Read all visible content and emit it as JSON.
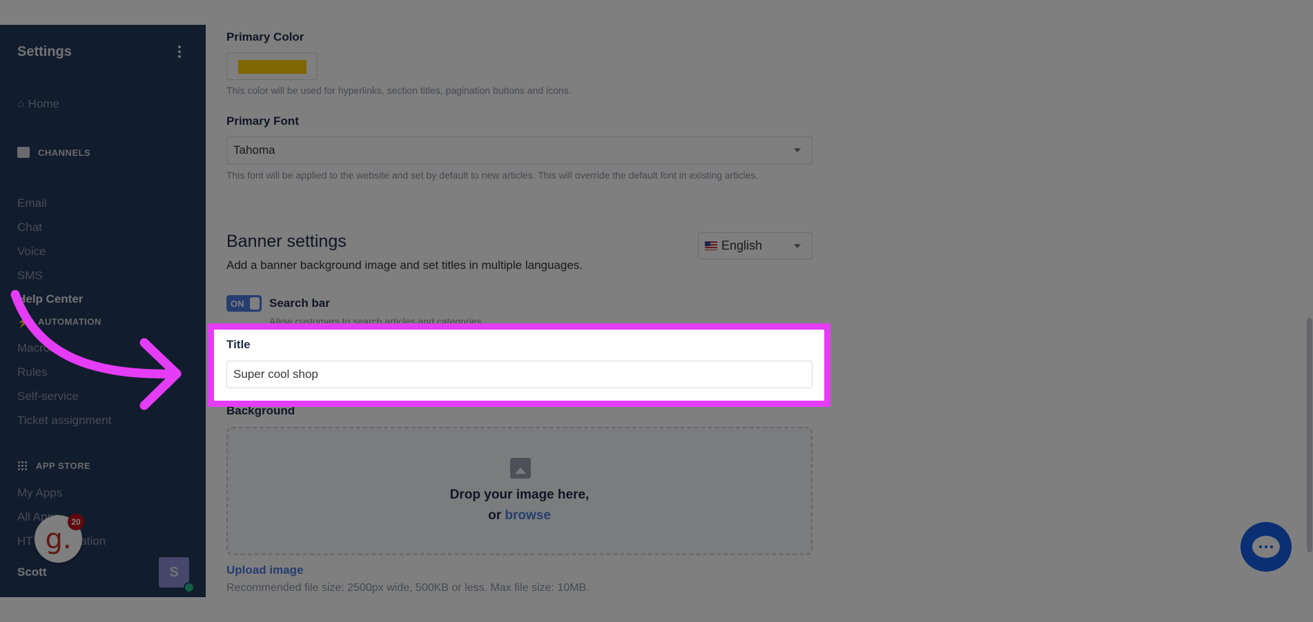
{
  "sidebar": {
    "title": "Settings",
    "home": "Home",
    "sections": [
      {
        "label": "CHANNELS",
        "icon": "chat-icon",
        "items": [
          "Email",
          "Chat",
          "Voice",
          "SMS",
          "Help Center"
        ]
      },
      {
        "label": "AUTOMATION",
        "icon": "bolt-icon",
        "items": [
          "Macros",
          "Rules",
          "Self-service",
          "Ticket assignment"
        ]
      },
      {
        "label": "APP STORE",
        "icon": "grid-icon",
        "items": [
          "My Apps",
          "All Apps",
          "HTTP integration"
        ]
      }
    ],
    "active_item": "Help Center",
    "user_name": "Scott",
    "avatar_initial": "S"
  },
  "main": {
    "primary_color": {
      "label": "Primary Color",
      "value": "#ffcc00",
      "help": "This color will be used for hyperlinks, section titles, pagination buttons and icons."
    },
    "primary_font": {
      "label": "Primary Font",
      "value": "Tahoma",
      "help": "This font will be applied to the website and set by default to new articles. This will override the default font in existing articles."
    },
    "banner": {
      "title": "Banner settings",
      "subtitle": "Add a banner background image and set titles in multiple languages.",
      "language": "English",
      "search_toggle": "ON",
      "search_label": "Search bar",
      "search_help": "Allow customers to search articles and categories",
      "title_label": "Title",
      "title_value": "Super cool shop",
      "background_label": "Background",
      "drop_text": "Drop your image here,",
      "drop_or": "or",
      "browse": "browse",
      "upload_link": "Upload image",
      "upload_help": "Recommended file size: 2500px wide, 500KB or less. Max file size: 10MB."
    }
  },
  "widgets": {
    "gorgias_logo": "g.",
    "notification_count": "20"
  },
  "colors": {
    "highlight": "#e53cf5",
    "accent": "#4a7be0",
    "sidebar": "#23395b"
  }
}
